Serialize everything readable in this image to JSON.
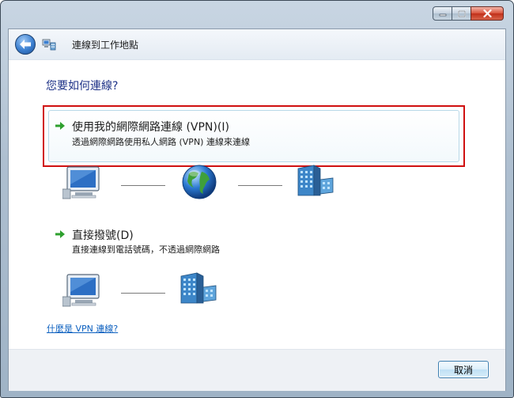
{
  "window": {
    "title": "連線到工作地點",
    "caption_buttons": [
      "minimize-icon",
      "maximize-icon",
      "close-icon"
    ]
  },
  "question": "您要如何連線?",
  "options": [
    {
      "title": "使用我的網際網路連線 (VPN)(I)",
      "description": "透過網際網路使用私人網路 (VPN) 連線來連線",
      "highlighted": true,
      "diagram": [
        "computer-icon",
        "globe-icon",
        "building-icon"
      ]
    },
    {
      "title": "直接撥號(D)",
      "description": "直接連線到電話號碼，不透過網際網路",
      "highlighted": false,
      "diagram": [
        "computer-icon",
        "building-icon"
      ]
    }
  ],
  "help_link": "什麼是 VPN 連線?",
  "footer": {
    "cancel_label": "取消"
  },
  "colors": {
    "accent_text": "#1e3287",
    "highlight_border": "#d01010",
    "link": "#0b5fbf",
    "arrow": "#2ea02e"
  }
}
